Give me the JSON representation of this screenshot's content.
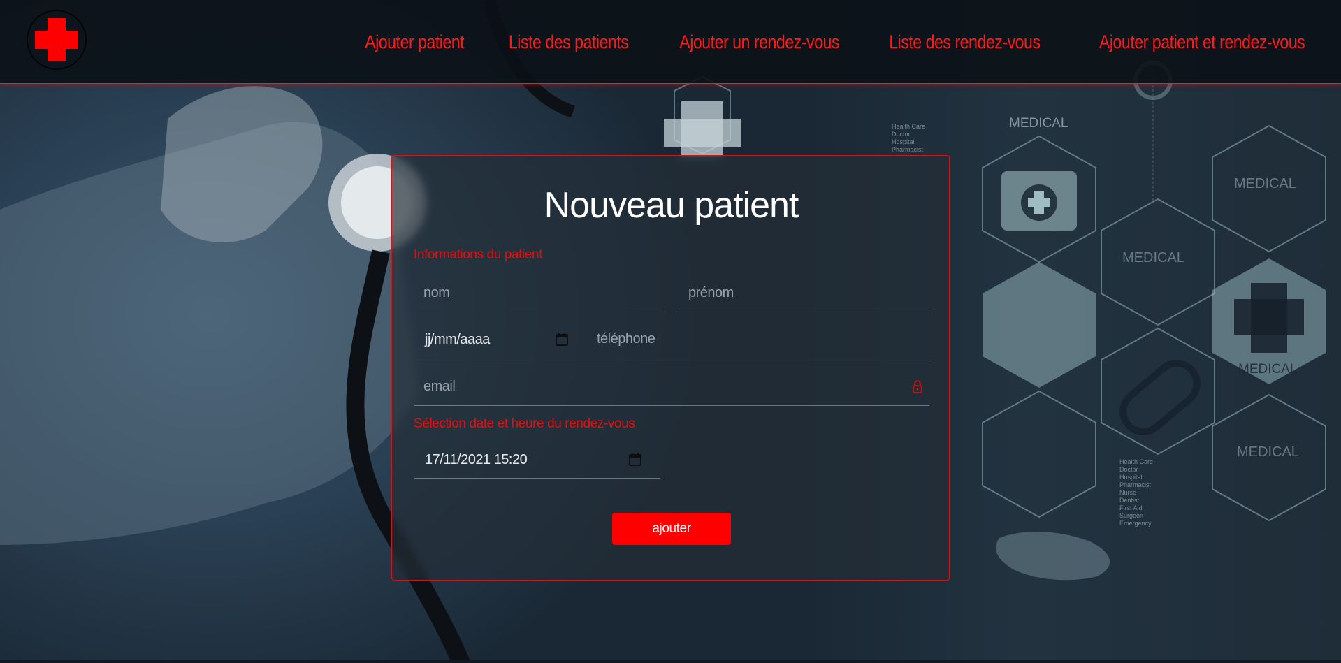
{
  "brand": {
    "logo_icon": "red-cross-icon",
    "accent_color": "#ff0000"
  },
  "nav": {
    "items": [
      {
        "label": "Ajouter patient"
      },
      {
        "label": "Liste des patients"
      },
      {
        "label": "Ajouter un rendez-vous"
      },
      {
        "label": "Liste des rendez-vous"
      },
      {
        "label": "Ajouter patient et rendez-vous"
      }
    ]
  },
  "background": {
    "words": [
      "MEDICAL",
      "MEDICAL",
      "MEDICAL",
      "MEDICAL",
      "MEDICAL"
    ],
    "small_lists": [
      [
        "Health Care",
        "Doctor",
        "Hospital",
        "Pharmacist"
      ],
      [
        "Health Care",
        "Doctor",
        "Hospital",
        "Pharmacist",
        "Nurse",
        "Dentist",
        "First Aid",
        "Surgeon",
        "Emergency"
      ]
    ]
  },
  "form": {
    "title": "Nouveau patient",
    "patient_section_label": "Informations du patient",
    "nom_placeholder": "nom",
    "prenom_placeholder": "prénom",
    "birthdate_placeholder": "jj/mm/aaaa",
    "telephone_placeholder": "téléphone",
    "email_placeholder": "email",
    "appointment_section_label": "Sélection date et heure du rendez-vous",
    "appointment_value": "17/11/2021 15:20",
    "submit_label": "ajouter"
  }
}
